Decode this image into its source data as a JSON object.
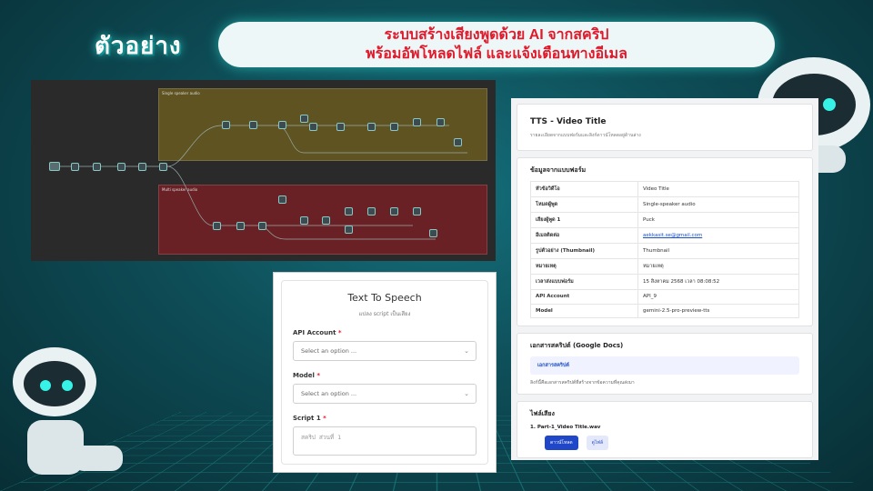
{
  "header": {
    "example_label": "ตัวอย่าง",
    "title_line1": "ระบบสร้างเสียงพูดด้วย AI จากสคริป",
    "title_line2": "พร้อมอัพโหลดไฟล์ และแจ้งเตือนทางอีเมล"
  },
  "workflow": {
    "lane_single": "Single speaker audio",
    "lane_multi": "Multi speaker audio"
  },
  "form": {
    "title": "Text To Speech",
    "subtitle": "แปลง script เป็นเสียง",
    "api_label": "API Account",
    "api_placeholder": "Select an option ...",
    "model_label": "Model",
    "model_placeholder": "Select an option ...",
    "script_label": "Script 1",
    "script_placeholder": "สคริป ส่วนที่ 1",
    "required_mark": "*"
  },
  "email": {
    "title": "TTS - Video Title",
    "subtitle": "รายละเอียดจากแบบฟอร์มและลิงก์ดาวน์โหลดอยู่ด้านล่าง",
    "form_section": "ข้อมูลจากแบบฟอร์ม",
    "rows": [
      {
        "k": "หัวข้อวิดีโอ",
        "v": "Video Title"
      },
      {
        "k": "โหมดผู้พูด",
        "v": "Single-speaker audio"
      },
      {
        "k": "เสียงผู้พูด 1",
        "v": "Puck"
      },
      {
        "k": "อีเมลติดต่อ",
        "v": "aekkasit.se@gmail.com"
      },
      {
        "k": "รูปตัวอย่าง (Thumbnail)",
        "v": "Thumbnail"
      },
      {
        "k": "หมายเหตุ",
        "v": "หมายเหตุ"
      },
      {
        "k": "เวลาส่งแบบฟอร์ม",
        "v": "15 สิงหาคม 2568 เวลา 08:08:52"
      },
      {
        "k": "API Account",
        "v": "API_9"
      },
      {
        "k": "Model",
        "v": "gemini-2.5-pro-preview-tts"
      }
    ],
    "doc_section": "เอกสารสคริปต์ (Google Docs)",
    "doc_link": "เอกสารสคริปต์",
    "doc_note": "ลิงก์นี้คือเอกสารสคริปต์ที่สร้างจากข้อความที่คุณส่งมา",
    "files_section": "ไฟล์เสียง",
    "file_name": "1.  Part-1_Video Title.wav",
    "download_label": "ดาวน์โหลด",
    "view_label": "ดูไฟล์"
  },
  "colors": {
    "accent": "#2fe3d6",
    "title_red": "#e0192b",
    "button_blue": "#1f47c8"
  }
}
